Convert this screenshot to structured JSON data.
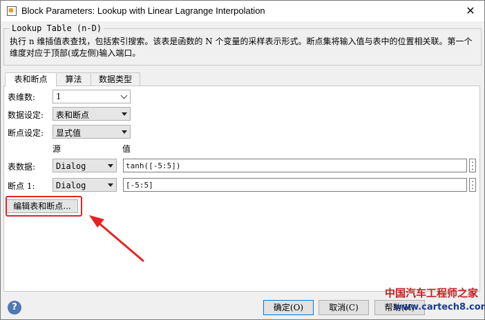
{
  "window": {
    "title": "Block Parameters: Lookup with Linear Lagrange Interpolation",
    "close_glyph": "✕"
  },
  "group": {
    "legend": "Lookup Table (n-D)",
    "description": "执行 n 维插值表查找，包括索引搜索。该表是函数的 N 个变量的采样表示形式。断点集将输入值与表中的位置相关联。第一个维度对应于顶部(或左侧)输入端口。"
  },
  "tabs": [
    {
      "label": "表和断点",
      "active": true
    },
    {
      "label": "算法",
      "active": false
    },
    {
      "label": "数据类型",
      "active": false
    }
  ],
  "form": {
    "dims_label": "表维数:",
    "dims_value": "1",
    "data_spec_label": "数据设定:",
    "data_spec_value": "表和断点",
    "bp_spec_label": "断点设定:",
    "bp_spec_value": "显式值",
    "col_source": "源",
    "col_value": "值",
    "table_data_label": "表数据:",
    "table_data_source": "Dialog",
    "table_data_value": "tanh([-5:5])",
    "bp1_label": "断点 1:",
    "bp1_source": "Dialog",
    "bp1_value": "[-5:5]",
    "edit_button": "编辑表和断点..."
  },
  "buttons": {
    "ok": "确定(O)",
    "cancel": "取消(C)",
    "help": "帮助(H)"
  },
  "watermark": {
    "text": "中国汽车工程师之家",
    "url": "www.cartech8.com"
  },
  "colors": {
    "highlight": "#e52222",
    "arrow": "#e52222"
  }
}
